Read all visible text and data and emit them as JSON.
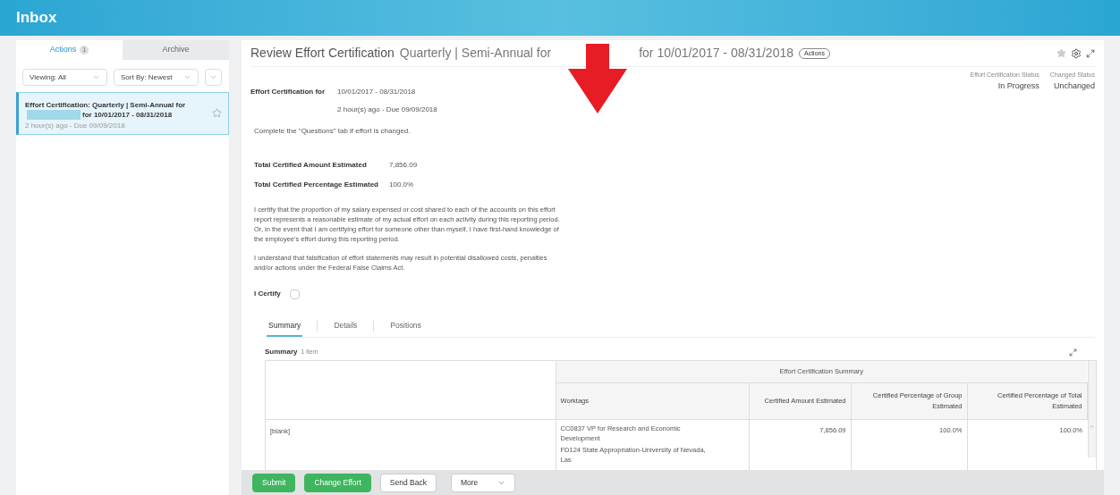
{
  "header": {
    "title": "Inbox"
  },
  "sidebar": {
    "tabs": [
      {
        "label": "Actions",
        "count": "1",
        "selected": true
      },
      {
        "label": "Archive",
        "selected": false
      }
    ],
    "filters": [
      "Viewing: All",
      "Sort By: Newest"
    ],
    "items": [
      {
        "title_start": "Effort Certification: Quarterly | Semi-Annual for",
        "title_end": "for 10/01/2017 - 08/31/2018",
        "meta": "2 hour(s) ago - Due 09/09/2018",
        "selected": true,
        "starred": false
      }
    ]
  },
  "main": {
    "title": "Review Effort Certification",
    "subtitle_start": "Quarterly | Semi-Annual for",
    "subtitle_end": "for 10/01/2017 - 08/31/2018",
    "actions_button": "Actions",
    "favorite": false,
    "statuses": [
      {
        "label": "Effort Certification Status",
        "value": "In Progress"
      },
      {
        "label": "Changed Status",
        "value": "Unchanged"
      }
    ],
    "certification_label": "Effort Certification for",
    "certification_period": "10/01/2017 - 08/31/2018",
    "certification_meta": "2 hour(s) ago - Due 09/09/2018",
    "instruction": "Complete the \"Questions\" tab if effort is changed.",
    "totals": [
      {
        "label": "Total Certified Amount Estimated",
        "value": "7,856.09"
      },
      {
        "label": "Total Certified Percentage Estimated",
        "value": "100.0%"
      }
    ],
    "paragraphs": [
      "I certify that the proportion of my salary expensed or cost shared to each of the accounts on this effort report represents a reasonable estimate of my actual effort on each activity during this reporting period. Or, in the event that I am certifying effort for someone other than myself, I have first-hand knowledge of the employee's effort during this reporting period.",
      "I understand that falsification of effort statements may result in potential disallowed costs, penalties and/or actions under the Federal False Claims Act."
    ],
    "certify": {
      "label": "I Certify",
      "checked": false
    },
    "tabs": [
      {
        "label": "Summary",
        "selected": true
      },
      {
        "label": "Details",
        "selected": false
      },
      {
        "label": "Positions",
        "selected": false
      }
    ],
    "table": {
      "title": "Summary",
      "count": "1 item",
      "group_header": "Effort Certification Summary",
      "columns": [
        "Worktags",
        "Certified Amount Estimated",
        "Certified Percentage of Group Estimated",
        "Certified Percentage of Total Estimated"
      ],
      "rows": [
        {
          "column_1": "[blank]",
          "worktags": [
            "CC0837 VP for Research and Economic Development",
            "FD124 State Appropriation-University of Nevada, Las"
          ],
          "amount": "7,856.09",
          "percent_group": "100.0%",
          "percent_total": "100.0%"
        }
      ]
    }
  },
  "footer": {
    "buttons": [
      {
        "label": "Submit",
        "kind": "primary"
      },
      {
        "label": "Change Effort",
        "kind": "primary"
      },
      {
        "label": "Send Back",
        "kind": "secondary"
      },
      {
        "label": "More",
        "kind": "dropdown"
      }
    ]
  }
}
